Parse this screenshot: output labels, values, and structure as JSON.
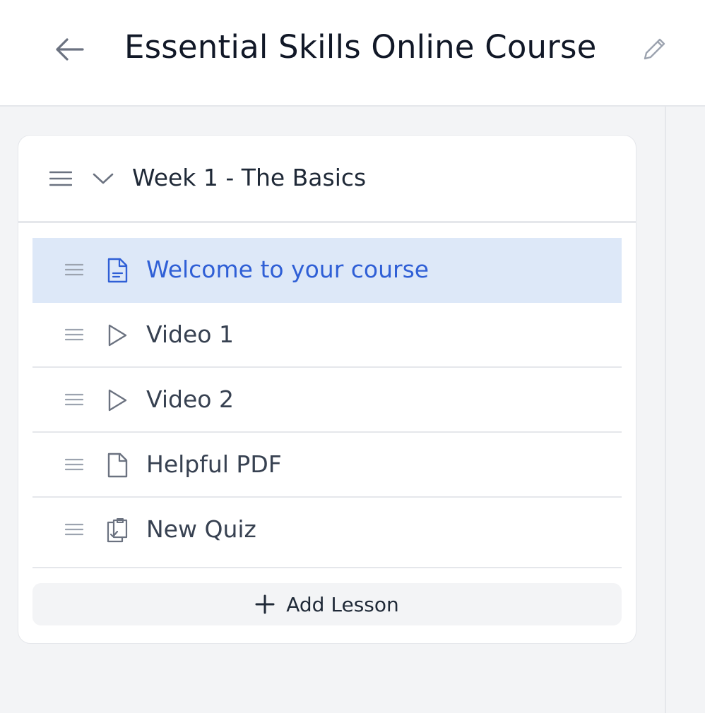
{
  "header": {
    "title": "Essential Skills Online Course",
    "back_icon": "arrow-left-icon",
    "edit_icon": "pencil-icon"
  },
  "module": {
    "title": "Week 1 - The Basics",
    "drag_icon": "drag-handle-icon",
    "collapse_icon": "chevron-down-icon",
    "lessons": [
      {
        "label": "Welcome to your course",
        "icon": "text-document-icon",
        "selected": true
      },
      {
        "label": "Video 1",
        "icon": "play-icon",
        "selected": false
      },
      {
        "label": "Video 2",
        "icon": "play-icon",
        "selected": false
      },
      {
        "label": "Helpful PDF",
        "icon": "file-icon",
        "selected": false
      },
      {
        "label": "New Quiz",
        "icon": "clipboard-check-icon",
        "selected": false
      }
    ],
    "add_lesson_label": "Add Lesson"
  },
  "colors": {
    "accent": "#2f5fd6",
    "selected_bg": "#dde8f8",
    "page_bg": "#f3f4f6"
  }
}
